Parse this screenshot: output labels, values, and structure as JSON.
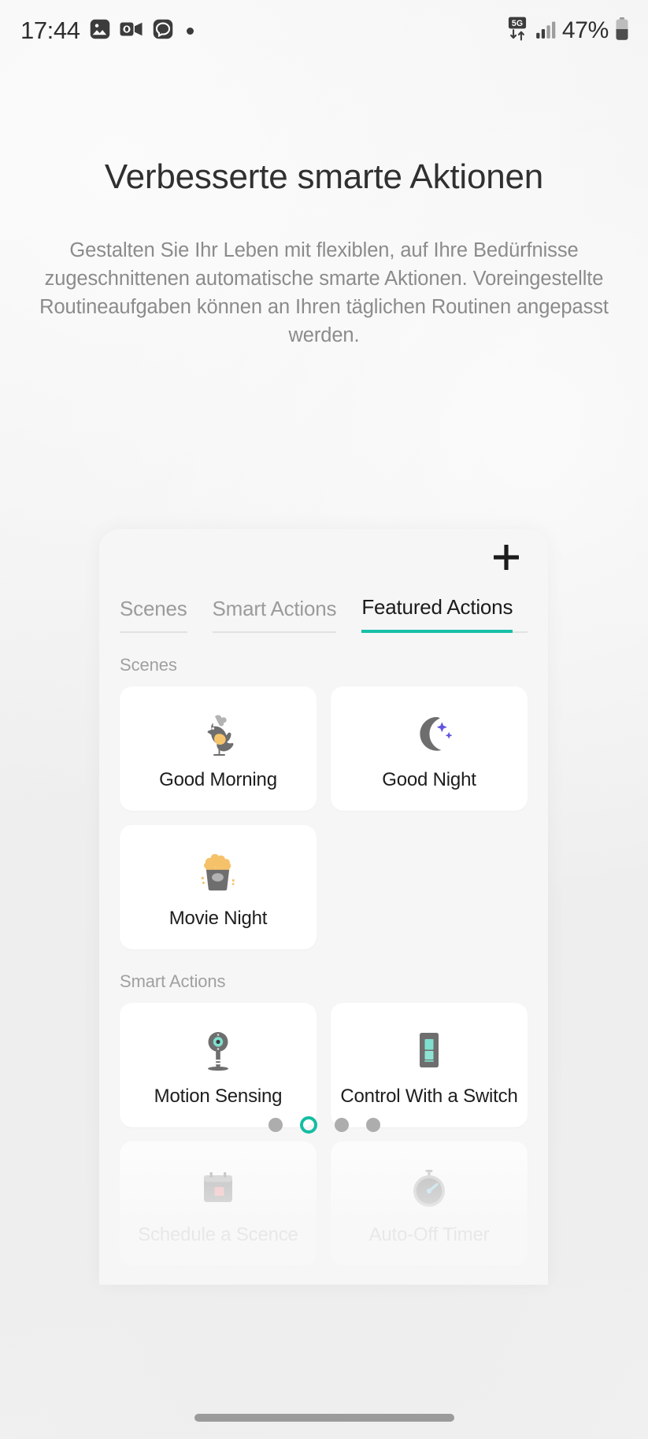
{
  "status_bar": {
    "time": "17:44",
    "battery_percent": "47%",
    "network_label": "5G",
    "icons": [
      "photos-icon",
      "outlook-icon",
      "messaging-icon",
      "notification-dot-icon",
      "5g-network-icon",
      "signal-bars-icon",
      "battery-icon"
    ]
  },
  "hero": {
    "title": "Verbesserte smarte Aktionen",
    "subtitle": "Gestalten Sie Ihr Leben mit flexiblen, auf Ihre Bedürfnisse zugeschnittenen automatische smarte Aktionen. Voreingestellte Routineaufgaben können an Ihren täglichen Routinen angepasst werden."
  },
  "card": {
    "add_button_label": "+",
    "tabs": [
      {
        "label": "Scenes",
        "active": false
      },
      {
        "label": "Smart Actions",
        "active": false
      },
      {
        "label": "Featured Actions",
        "active": true
      }
    ],
    "sections": [
      {
        "label": "Scenes",
        "tiles": [
          {
            "label": "Good Morning",
            "icon": "rooster-icon",
            "faded": false
          },
          {
            "label": "Good Night",
            "icon": "moon-stars-icon",
            "faded": false
          },
          {
            "label": "Movie Night",
            "icon": "popcorn-icon",
            "faded": false
          }
        ]
      },
      {
        "label": "Smart Actions",
        "tiles": [
          {
            "label": "Motion Sensing",
            "icon": "motion-sensor-icon",
            "faded": false
          },
          {
            "label": "Control With a Switch",
            "icon": "wall-switch-icon",
            "faded": false
          },
          {
            "label": "Schedule a Scence",
            "icon": "calendar-icon",
            "faded": true
          },
          {
            "label": "Auto-Off Timer",
            "icon": "stopwatch-icon",
            "faded": true
          }
        ]
      }
    ],
    "pager": {
      "count": 4,
      "active_index": 1
    }
  },
  "colors": {
    "accent": "#14bda3",
    "tab_underline": "#17bfa8",
    "background": "#f1f1f1",
    "card_background": "#f6f6f6",
    "tile_background": "#ffffff",
    "title_text": "#303030",
    "subtitle_text": "#8b8b8b"
  }
}
